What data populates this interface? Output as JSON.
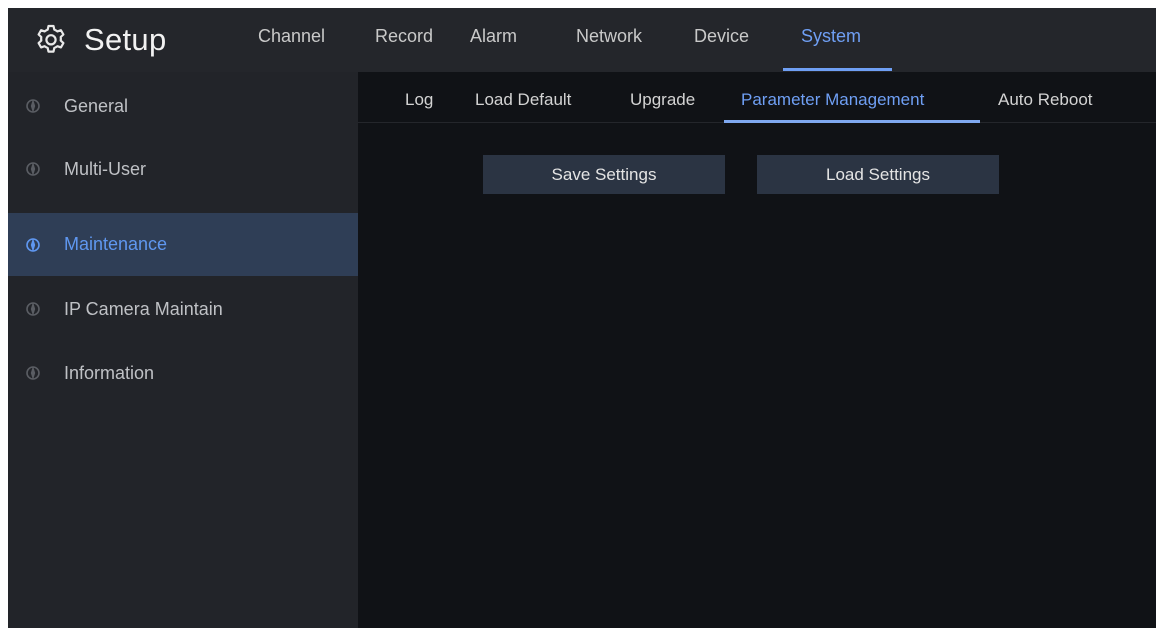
{
  "header": {
    "title": "Setup",
    "icon": "gear-icon",
    "tabs": [
      {
        "label": "Channel",
        "active": false
      },
      {
        "label": "Record",
        "active": false
      },
      {
        "label": "Alarm",
        "active": false
      },
      {
        "label": "Network",
        "active": false
      },
      {
        "label": "Device",
        "active": false
      },
      {
        "label": "System",
        "active": true
      }
    ]
  },
  "sidebar": {
    "items": [
      {
        "label": "General",
        "icon": "compass-icon",
        "active": false
      },
      {
        "label": "Multi-User",
        "icon": "compass-icon",
        "active": false
      },
      {
        "label": "Maintenance",
        "icon": "compass-icon",
        "active": true
      },
      {
        "label": "IP Camera Maintain",
        "icon": "compass-icon",
        "active": false
      },
      {
        "label": "Information",
        "icon": "compass-icon",
        "active": false
      }
    ]
  },
  "main": {
    "subtabs": [
      {
        "label": "Log",
        "active": false
      },
      {
        "label": "Load Default",
        "active": false
      },
      {
        "label": "Upgrade",
        "active": false
      },
      {
        "label": "Parameter Management",
        "active": true
      },
      {
        "label": "Auto Reboot",
        "active": false
      }
    ],
    "buttons": {
      "save_label": "Save Settings",
      "load_label": "Load Settings"
    }
  },
  "colors": {
    "accent": "#6f9ff4",
    "sidebar_active_bg": "#2f3e56",
    "background": "#0f1115"
  }
}
